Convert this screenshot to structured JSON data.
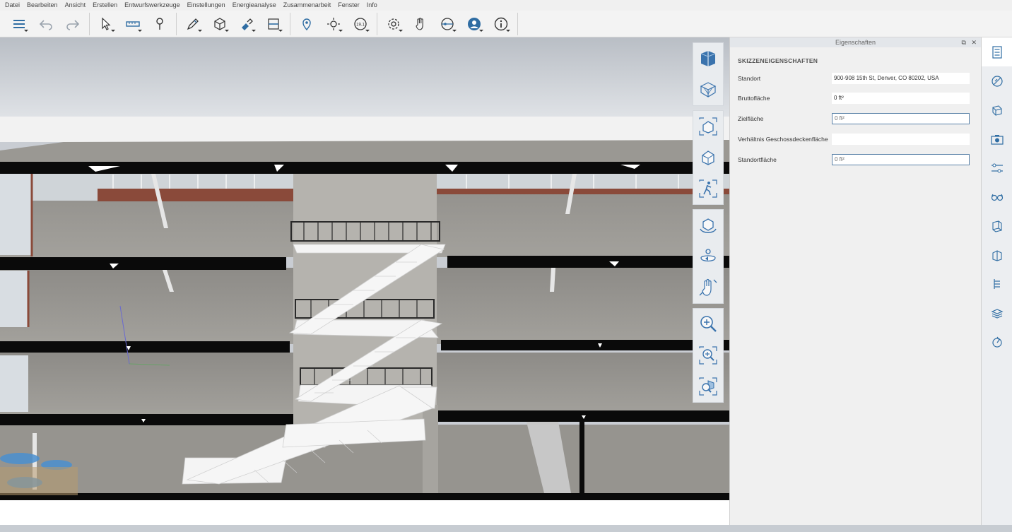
{
  "menu": [
    "Datei",
    "Bearbeiten",
    "Ansicht",
    "Erstellen",
    "Entwurfswerkzeuge",
    "Einstellungen",
    "Energieanalyse",
    "Zusammenarbeit",
    "Fenster",
    "Info"
  ],
  "toolbar_icons": [
    "list-icon",
    "undo-icon",
    "redo-icon",
    "select-arrow-icon",
    "measure-icon",
    "pushpin-icon",
    "pencil-icon",
    "box-icon",
    "paint-icon",
    "section-icon",
    "location-pin-icon",
    "sun-icon",
    "timeline-icon",
    "gear-icon",
    "hand-icon",
    "globe-icon",
    "user-icon",
    "info-icon"
  ],
  "toolbar_badge": "19.1",
  "properties": {
    "panel_title": "Eigenschaften",
    "section": "SKIZZENEIGENSCHAFTEN",
    "rows": [
      {
        "label": "Standort",
        "value": "900-908 15th St, Denver, CO 80202, USA"
      },
      {
        "label": "Bruttofläche",
        "value": "0 ft²"
      },
      {
        "label": "Zielfläche",
        "value": "0 ft²"
      },
      {
        "label": "Verhältnis Geschossdeckenfläche",
        "value": ""
      },
      {
        "label": "Standortfläche",
        "value": "0 ft²"
      }
    ]
  },
  "colors": {
    "accent": "#2f6da3",
    "floor": "#8e8c88",
    "slab": "#0a0a0a"
  }
}
